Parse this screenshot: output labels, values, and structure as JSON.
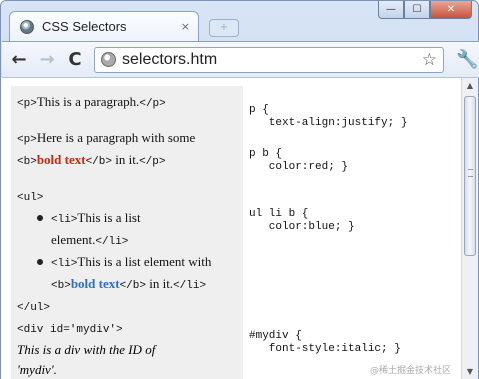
{
  "window": {
    "tab_title": "CSS Selectors",
    "tab_close": "×",
    "newtab_glyph": "+",
    "minimize": "—",
    "maximize": "☐",
    "close": "✕"
  },
  "toolbar": {
    "back_glyph": "←",
    "forward_glyph": "→",
    "reload_glyph": "C",
    "url": "selectors.htm",
    "star_glyph": "☆",
    "wrench_glyph": "🔧"
  },
  "page": {
    "p1": {
      "open": "<p>",
      "text": "This is a paragraph.",
      "close": "</p>"
    },
    "p2": {
      "open": "<p>",
      "text": "Here is a paragraph with some",
      "b_open": "<b>",
      "bold": "bold text",
      "b_close": "</b>",
      "after": " in it.",
      "close": "</p>"
    },
    "ul_open": "<ul>",
    "li1": {
      "open": "<li>",
      "text_line1": "This is a list",
      "text_line2": "element.",
      "close": "</li>"
    },
    "li2": {
      "open": "<li>",
      "text_line1": "This is a list element with",
      "b_open": "<b>",
      "bold": "bold text",
      "b_close": "</b>",
      "after": " in it.",
      "close": "</li>"
    },
    "ul_close": "</ul>",
    "div_open": "<div id='mydiv'>",
    "div_text_line1": "This is a div with the ID of",
    "div_text_line2": "'mydiv'."
  },
  "css": {
    "rule1": [
      "p {",
      "   text-align:justify; }"
    ],
    "rule2": [
      "p b {",
      "   color:red; }"
    ],
    "rule3": [
      "ul li b {",
      "   color:blue; }"
    ],
    "rule4": [
      "#mydiv {",
      "   font-style:italic; }"
    ]
  },
  "scrollbar": {
    "up": "▲",
    "down": "▼"
  },
  "watermark": "@稀土掘金技术社区",
  "colors": {
    "red_bold": "#c8290a",
    "blue_bold": "#2a6fcf",
    "pane_bg": "#efefef"
  }
}
